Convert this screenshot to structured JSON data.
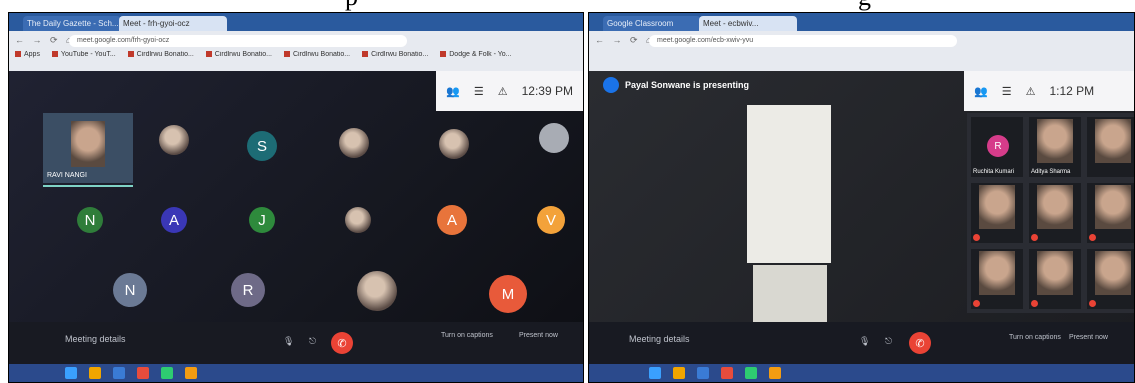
{
  "caption": {
    "left_text": "p",
    "right_text": "g"
  },
  "screen1": {
    "tabs": [
      "Meet - frh-gyoi-ocz",
      "The Daily Gazette - Sch..."
    ],
    "address": "meet.google.com/frh-gyoi-ocz",
    "bookmarks": [
      "Apps",
      "YouTube - YouT...",
      "Cirdlrwu Bonatio...",
      "Cirdlrwu Bonatio...",
      "Cirdlrwu Bonatio...",
      "Cirdlrwu Bonatio...",
      "Dodge & Folk - Yo..."
    ],
    "clock": "12:39 PM",
    "self_name": "RAVI NANGI",
    "meeting_details": "Meeting details",
    "participants": [
      {
        "initial": "",
        "color": "#7d8aa8"
      },
      {
        "initial": "S",
        "color": "#1d6c75"
      },
      {
        "initial": "",
        "color": "#5b4a40"
      },
      {
        "initial": "",
        "color": "#5b4a40"
      },
      {
        "initial": "",
        "color": "#a8acb4"
      },
      {
        "initial": "N",
        "color": "#2f7d3a"
      },
      {
        "initial": "A",
        "color": "#3a37b6"
      },
      {
        "initial": "J",
        "color": "#2e8a3c"
      },
      {
        "initial": "",
        "color": "#5b4a40"
      },
      {
        "initial": "A",
        "color": "#e8743b"
      },
      {
        "initial": "V",
        "color": "#f3a23a"
      },
      {
        "initial": "N",
        "color": "#6b7a95"
      },
      {
        "initial": "R",
        "color": "#6e6a87"
      },
      {
        "initial": "",
        "color": "#8a7468"
      },
      {
        "initial": "M",
        "color": "#e85a3a"
      }
    ],
    "controls": {
      "captions": "Turn on captions",
      "present": "Present now"
    }
  },
  "screen2": {
    "tabs": [
      "Google Classroom",
      "Meet - ecbwiv..."
    ],
    "address": "meet.google.com/ecb-xwiv-yvu",
    "presenting_text": "Payal Sonwane is presenting",
    "clock": "1:12 PM",
    "meeting_details": "Meeting details",
    "grid": [
      {
        "name": "Ruchita Kumari",
        "initial": "R",
        "color": "#d63c8a"
      },
      {
        "name": "Aditya Sharma",
        "initial": "",
        "color": ""
      },
      {
        "name": "",
        "initial": "",
        "color": ""
      },
      {
        "name": "",
        "initial": "",
        "color": ""
      },
      {
        "name": "",
        "initial": "",
        "color": ""
      },
      {
        "name": "",
        "initial": "",
        "color": ""
      },
      {
        "name": "",
        "initial": "",
        "color": ""
      },
      {
        "name": "",
        "initial": "",
        "color": ""
      },
      {
        "name": "",
        "initial": "",
        "color": ""
      }
    ],
    "controls": {
      "captions": "Turn on captions",
      "present": "Present now"
    }
  }
}
